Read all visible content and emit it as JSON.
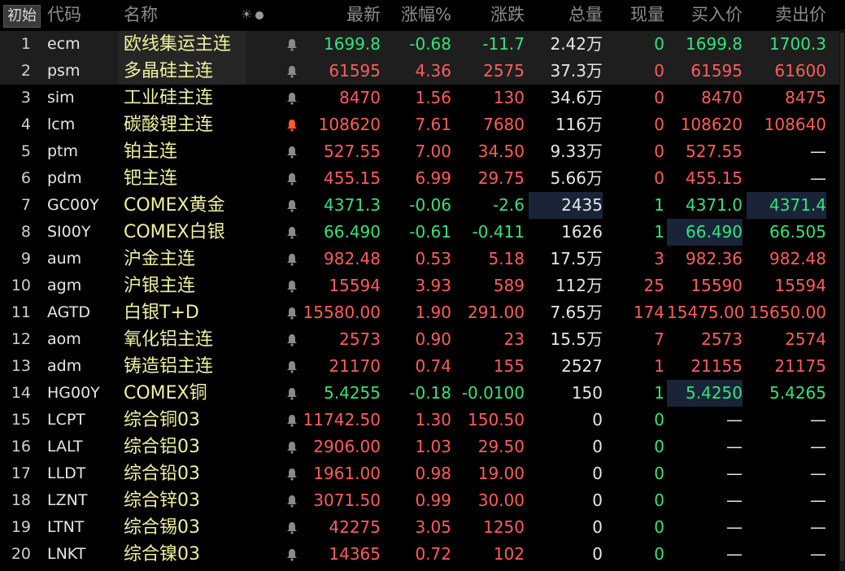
{
  "header": {
    "tag": "初始",
    "cols": {
      "code": "代码",
      "name": "名称",
      "last": "最新",
      "pct": "涨幅%",
      "chg": "涨跌",
      "vol": "总量",
      "cur": "现量",
      "bid": "买入价",
      "ask": "卖出价"
    },
    "icons": [
      "sun-icon",
      "dot-icon"
    ]
  },
  "colors": {
    "up": "#ff5c5c",
    "down": "#33e37a",
    "name": "#f0f0a0",
    "bell_active": "#ff5533"
  },
  "rows": [
    {
      "idx": "1",
      "code": "ecm",
      "name": "欧线集运主连",
      "last": "1699.8",
      "pct": "-0.68",
      "chg": "-11.7",
      "vol": "2.42万",
      "cur": "0",
      "bid": "1699.8",
      "ask": "1700.3",
      "dir": "down",
      "bell": "normal"
    },
    {
      "idx": "2",
      "code": "psm",
      "name": "多晶硅主连",
      "last": "61595",
      "pct": "4.36",
      "chg": "2575",
      "vol": "37.3万",
      "cur": "0",
      "bid": "61595",
      "ask": "61600",
      "dir": "up",
      "bell": "normal"
    },
    {
      "idx": "3",
      "code": "sim",
      "name": "工业硅主连",
      "last": "8470",
      "pct": "1.56",
      "chg": "130",
      "vol": "34.6万",
      "cur": "0",
      "bid": "8470",
      "ask": "8475",
      "dir": "up",
      "bell": "normal"
    },
    {
      "idx": "4",
      "code": "lcm",
      "name": "碳酸锂主连",
      "last": "108620",
      "pct": "7.61",
      "chg": "7680",
      "vol": "116万",
      "cur": "0",
      "bid": "108620",
      "ask": "108640",
      "dir": "up",
      "bell": "active"
    },
    {
      "idx": "5",
      "code": "ptm",
      "name": "铂主连",
      "last": "527.55",
      "pct": "7.00",
      "chg": "34.50",
      "vol": "9.33万",
      "cur": "0",
      "bid": "527.55",
      "ask": "—",
      "dir": "up",
      "bell": "normal"
    },
    {
      "idx": "6",
      "code": "pdm",
      "name": "钯主连",
      "last": "455.15",
      "pct": "6.99",
      "chg": "29.75",
      "vol": "5.66万",
      "cur": "0",
      "bid": "455.15",
      "ask": "—",
      "dir": "up",
      "bell": "normal"
    },
    {
      "idx": "7",
      "code": "GC00Y",
      "name": "COMEX黄金",
      "last": "4371.3",
      "pct": "-0.06",
      "chg": "-2.6",
      "vol": "2435",
      "cur": "1",
      "bid": "4371.0",
      "ask": "4371.4",
      "dir": "down",
      "bell": "normal"
    },
    {
      "idx": "8",
      "code": "SI00Y",
      "name": "COMEX白银",
      "last": "66.490",
      "pct": "-0.61",
      "chg": "-0.411",
      "vol": "1626",
      "cur": "1",
      "bid": "66.490",
      "ask": "66.505",
      "dir": "down",
      "bell": "normal"
    },
    {
      "idx": "9",
      "code": "aum",
      "name": "沪金主连",
      "last": "982.48",
      "pct": "0.53",
      "chg": "5.18",
      "vol": "17.5万",
      "cur": "3",
      "bid": "982.36",
      "ask": "982.48",
      "dir": "up",
      "bell": "normal"
    },
    {
      "idx": "10",
      "code": "agm",
      "name": "沪银主连",
      "last": "15594",
      "pct": "3.93",
      "chg": "589",
      "vol": "112万",
      "cur": "25",
      "bid": "15590",
      "ask": "15594",
      "dir": "up",
      "bell": "normal"
    },
    {
      "idx": "11",
      "code": "AGTD",
      "name": "白银T+D",
      "last": "15580.00",
      "pct": "1.90",
      "chg": "291.00",
      "vol": "7.65万",
      "cur": "174",
      "bid": "15475.00",
      "ask": "15650.00",
      "dir": "up",
      "bell": "normal"
    },
    {
      "idx": "12",
      "code": "aom",
      "name": "氧化铝主连",
      "last": "2573",
      "pct": "0.90",
      "chg": "23",
      "vol": "15.5万",
      "cur": "7",
      "bid": "2573",
      "ask": "2574",
      "dir": "up",
      "bell": "normal"
    },
    {
      "idx": "13",
      "code": "adm",
      "name": "铸造铝主连",
      "last": "21170",
      "pct": "0.74",
      "chg": "155",
      "vol": "2527",
      "cur": "1",
      "bid": "21155",
      "ask": "21175",
      "dir": "up",
      "bell": "normal"
    },
    {
      "idx": "14",
      "code": "HG00Y",
      "name": "COMEX铜",
      "last": "5.4255",
      "pct": "-0.18",
      "chg": "-0.0100",
      "vol": "150",
      "cur": "1",
      "bid": "5.4250",
      "ask": "5.4265",
      "dir": "down",
      "bell": "normal"
    },
    {
      "idx": "15",
      "code": "LCPT",
      "name": "综合铜03",
      "last": "11742.50",
      "pct": "1.30",
      "chg": "150.50",
      "vol": "0",
      "cur": "0",
      "bid": "—",
      "ask": "—",
      "dir": "up",
      "bell": "normal"
    },
    {
      "idx": "16",
      "code": "LALT",
      "name": "综合铝03",
      "last": "2906.00",
      "pct": "1.03",
      "chg": "29.50",
      "vol": "0",
      "cur": "0",
      "bid": "—",
      "ask": "—",
      "dir": "up",
      "bell": "normal"
    },
    {
      "idx": "17",
      "code": "LLDT",
      "name": "综合铅03",
      "last": "1961.00",
      "pct": "0.98",
      "chg": "19.00",
      "vol": "0",
      "cur": "0",
      "bid": "—",
      "ask": "—",
      "dir": "up",
      "bell": "normal"
    },
    {
      "idx": "18",
      "code": "LZNT",
      "name": "综合锌03",
      "last": "3071.50",
      "pct": "0.99",
      "chg": "30.00",
      "vol": "0",
      "cur": "0",
      "bid": "—",
      "ask": "—",
      "dir": "up",
      "bell": "normal"
    },
    {
      "idx": "19",
      "code": "LTNT",
      "name": "综合锡03",
      "last": "42275",
      "pct": "3.05",
      "chg": "1250",
      "vol": "0",
      "cur": "0",
      "bid": "—",
      "ask": "—",
      "dir": "up",
      "bell": "normal"
    },
    {
      "idx": "20",
      "code": "LNKT",
      "name": "综合镍03",
      "last": "14365",
      "pct": "0.72",
      "chg": "102",
      "vol": "0",
      "cur": "0",
      "bid": "—",
      "ask": "—",
      "dir": "up",
      "bell": "normal"
    }
  ]
}
